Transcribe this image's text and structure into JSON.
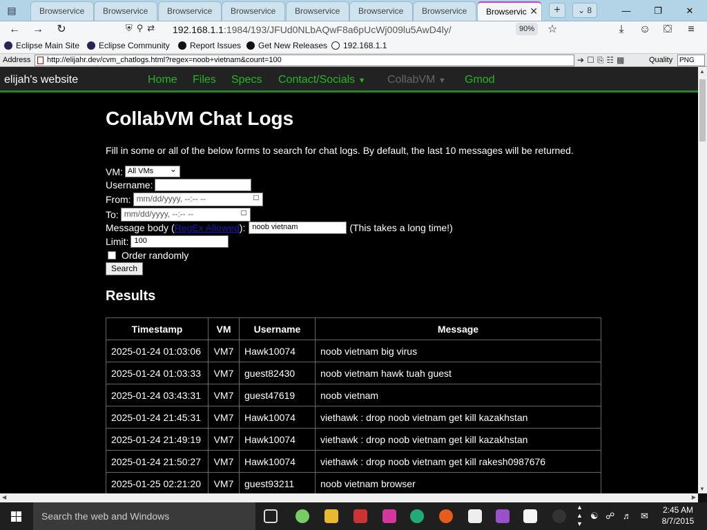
{
  "browser": {
    "tabs": [
      {
        "label": "Browservice"
      },
      {
        "label": "Browservice"
      },
      {
        "label": "Browservice"
      },
      {
        "label": "Browservice"
      },
      {
        "label": "Browservice"
      },
      {
        "label": "Browservice"
      },
      {
        "label": "Browservice"
      },
      {
        "label": "Browservic"
      }
    ],
    "tab_count": "8",
    "url_host": "192.168.1.1",
    "url_path": ":1984/193/JFUd0NLbAQwF8a6pUcWj009lu5AwD4ly/",
    "zoom": "90%",
    "bookmarks": [
      {
        "label": "Eclipse Main Site",
        "icon": "eclipse-icon"
      },
      {
        "label": "Eclipse Community",
        "icon": "eclipse-icon"
      },
      {
        "label": "Report Issues",
        "icon": "github-icon"
      },
      {
        "label": "Get New Releases",
        "icon": "github-icon"
      },
      {
        "label": "192.168.1.1",
        "icon": "globe-icon"
      }
    ]
  },
  "browservice": {
    "address_label": "Address",
    "address_value": "http://elijahr.dev/cvm_chatlogs.html?regex=noob+vietnam&count=100",
    "quality_label": "Quality",
    "quality_value": "PNG"
  },
  "site": {
    "title": "elijah's website",
    "nav": [
      {
        "label": "Home"
      },
      {
        "label": "Files"
      },
      {
        "label": "Specs"
      },
      {
        "label": "Contact/Socials"
      },
      {
        "label": "CollabVM"
      },
      {
        "label": "Gmod"
      }
    ]
  },
  "page": {
    "title": "CollabVM Chat Logs",
    "intro": "Fill in some or all of the below forms to search for chat logs. By default, the last 10 messages will be returned.",
    "form": {
      "vm_label": "VM:",
      "vm_value": "All VMs",
      "username_label": "Username:",
      "username_value": "",
      "from_label": "From:",
      "from_placeholder": "mm/dd/yyyy, --:-- --",
      "to_label": "To:",
      "to_placeholder": "mm/dd/yyyy, --:-- --",
      "message_label_pre": "Message body (",
      "message_label_link": "RegEx Allowed",
      "message_label_post": "):",
      "message_value": "noob vietnam",
      "message_note": "(This takes a long time!)",
      "limit_label": "Limit:",
      "limit_value": "100",
      "random_label": "Order randomly",
      "search_button": "Search"
    },
    "results_title": "Results",
    "table": {
      "headers": [
        "Timestamp",
        "VM",
        "Username",
        "Message"
      ],
      "rows": [
        [
          "2025-01-24 01:03:06",
          "VM7",
          "Hawk10074",
          "noob vietnam big virus"
        ],
        [
          "2025-01-24 01:03:33",
          "VM7",
          "guest82430",
          "noob vietnam hawk tuah guest"
        ],
        [
          "2025-01-24 03:43:31",
          "VM7",
          "guest47619",
          "noob vietnam"
        ],
        [
          "2025-01-24 21:45:31",
          "VM7",
          "Hawk10074",
          "viethawk : drop noob vietnam get kill kazakhstan"
        ],
        [
          "2025-01-24 21:49:19",
          "VM7",
          "Hawk10074",
          "viethawk : drop noob vietnam get kill kazakhstan"
        ],
        [
          "2025-01-24 21:50:27",
          "VM7",
          "Hawk10074",
          "viethawk : drop noob vietnam get kill rakesh0987676"
        ],
        [
          "2025-01-25 02:21:20",
          "VM7",
          "guest93211",
          "noob vietnam browser"
        ]
      ]
    }
  },
  "taskbar": {
    "search_placeholder": "Search the web and Windows",
    "time": "2:45 AM",
    "date": "8/7/2015"
  }
}
